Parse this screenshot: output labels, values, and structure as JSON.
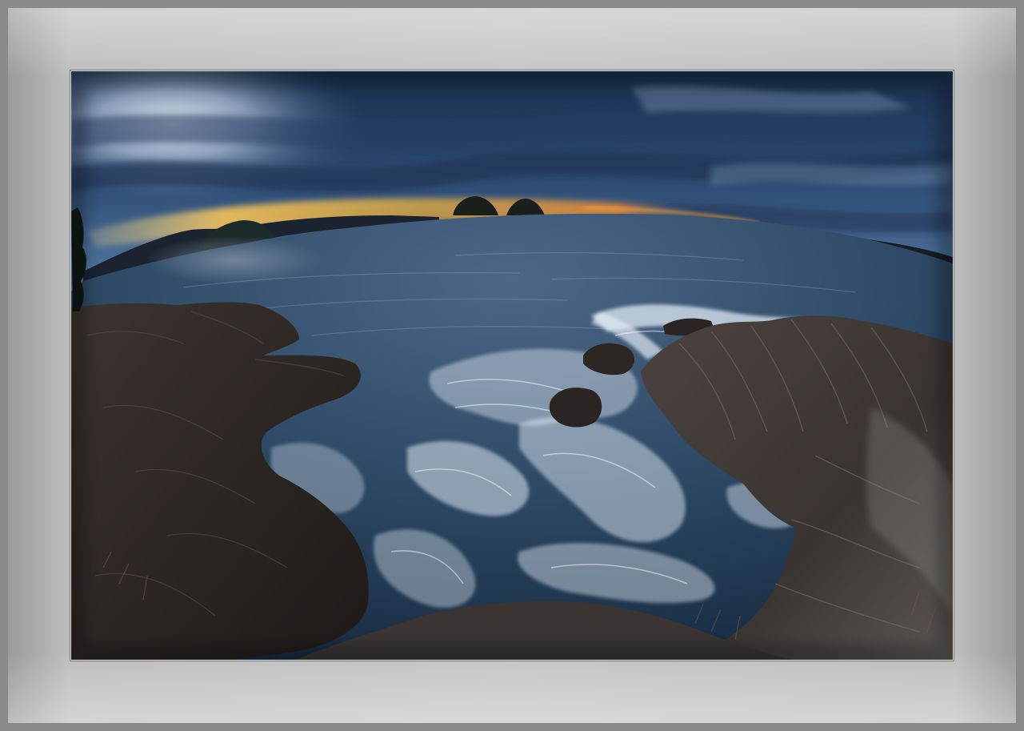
{
  "image": {
    "subject": "fisheye-seascape",
    "colors": {
      "frame": "#8a8a8a",
      "mat": "#c4c4c4",
      "sky_dark": "#1d3556",
      "sky_light": "#c9d7ea",
      "sunset": "#f2b43c",
      "sea": "#2e4a66",
      "foam": "#dfe9f3",
      "rock": "#2a2522"
    }
  }
}
